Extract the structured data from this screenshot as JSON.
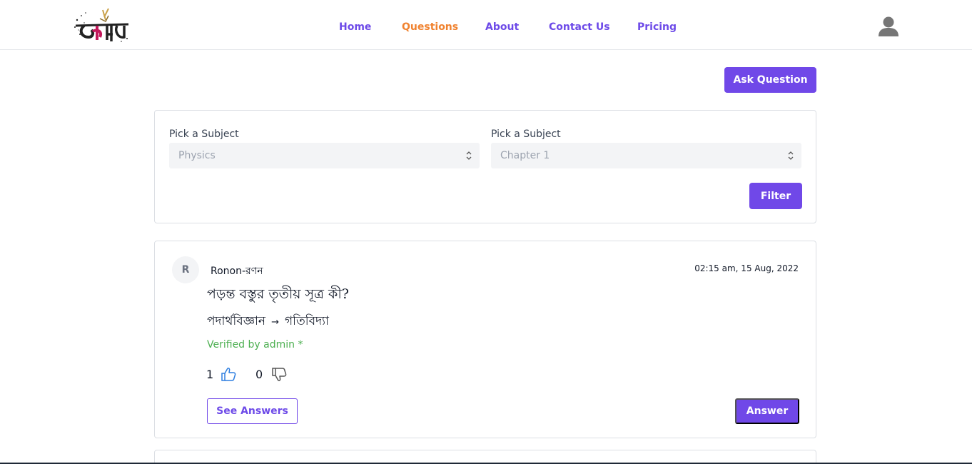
{
  "header": {
    "logo_icon": "brand-logo-icon",
    "nav": [
      {
        "label": "Home",
        "active": false
      },
      {
        "label": "Questions",
        "active": true
      },
      {
        "label": "About",
        "active": false
      },
      {
        "label": "Contact Us",
        "active": false
      },
      {
        "label": "Pricing",
        "active": false
      }
    ],
    "user_icon": "user-avatar-icon"
  },
  "ask_button": "Ask Question",
  "filter": {
    "subject_label": "Pick a Subject",
    "subject_value": "Physics",
    "chapter_label": "Pick a Subject",
    "chapter_value": "Chapter 1",
    "filter_button": "Filter"
  },
  "question": {
    "avatar_initial": "R",
    "author": "Ronon-রণন",
    "timestamp": "02:15 am, 15 Aug, 2022",
    "title": "পড়ন্ত বস্তুর তৃতীয় সূত্র কী?",
    "subject": "পদার্থবিজ্ঞান",
    "arrow": "→",
    "chapter": "গতিবিদ্যা",
    "verified": "Verified by admin *",
    "upvotes": "1",
    "downvotes": "0",
    "see_answers": "See Answers",
    "answer": "Answer"
  },
  "colors": {
    "primary": "#7048e8",
    "active_nav": "#f0822f",
    "verified": "#4caf50",
    "border": "#dcdfe4",
    "thumbs_up": "#2f7fe0"
  }
}
